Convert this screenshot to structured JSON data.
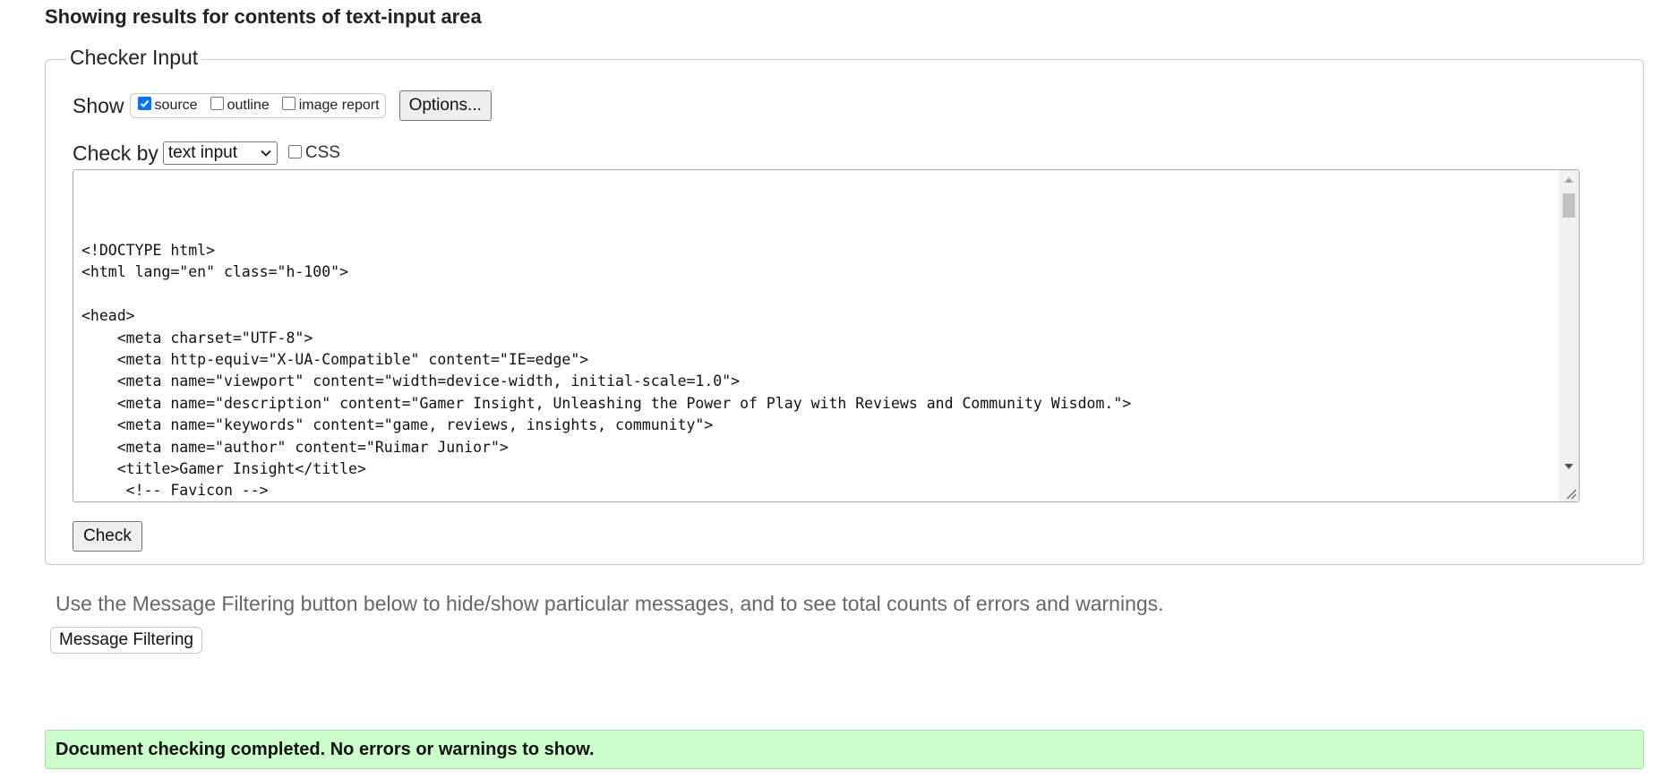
{
  "results_heading": "Showing results for contents of text-input area",
  "checker": {
    "legend": "Checker Input",
    "show_label": "Show",
    "show_options": [
      {
        "label": "source",
        "checked": true
      },
      {
        "label": "outline",
        "checked": false
      },
      {
        "label": "image report",
        "checked": false
      }
    ],
    "options_button": "Options...",
    "check_by_label": "Check by",
    "check_by_selected": "text input",
    "css_label": "CSS",
    "css_checked": false,
    "source_lines": [
      "<!DOCTYPE html>",
      "<html lang=\"en\" class=\"h-100\">",
      "",
      "<head>",
      "    <meta charset=\"UTF-8\">",
      "    <meta http-equiv=\"X-UA-Compatible\" content=\"IE=edge\">",
      "    <meta name=\"viewport\" content=\"width=device-width, initial-scale=1.0\">",
      "    <meta name=\"description\" content=\"Gamer Insight, Unleashing the Power of Play with Reviews and Community Wisdom.\">",
      "    <meta name=\"keywords\" content=\"game, reviews, insights, community\">",
      "    <meta name=\"author\" content=\"Ruimar Junior\">",
      "    <title>Gamer Insight</title>",
      "     <!-- Favicon -->"
    ],
    "check_button": "Check"
  },
  "filter_note": "Use the Message Filtering button below to hide/show particular messages, and to see total counts of errors and warnings.",
  "filter_button": "Message Filtering",
  "status_message": "Document checking completed. No errors or warnings to show.",
  "colors": {
    "success_bg": "#ccffcc",
    "checkbox_accent": "#0075ff"
  },
  "icons": {
    "select_arrow": "chevron-down-icon",
    "scroll_up": "triangle-up-icon",
    "scroll_down": "triangle-down-icon",
    "resize": "resize-grip-icon",
    "checkmark": "checkmark-icon"
  }
}
